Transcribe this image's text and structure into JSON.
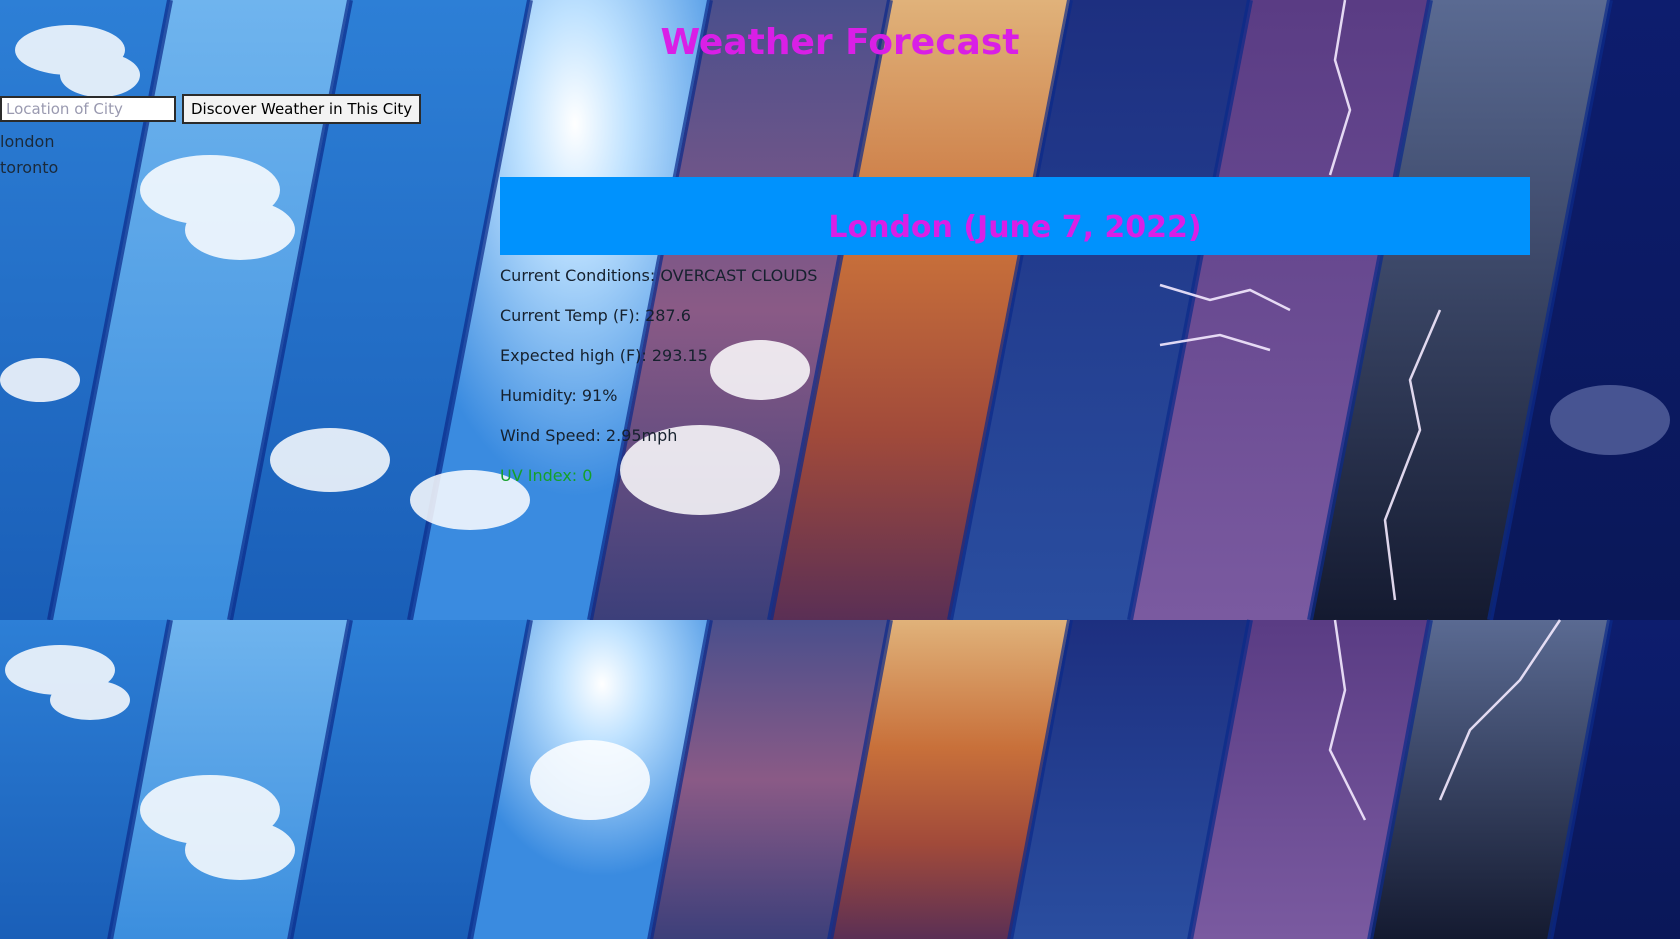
{
  "header": {
    "title": "Weather Forecast"
  },
  "search": {
    "placeholder": "Location of City",
    "value": "",
    "button_label": "Discover Weather in This City"
  },
  "history": {
    "items": [
      "london",
      "toronto"
    ]
  },
  "current": {
    "heading": "London (June 7, 2022)",
    "conditions": "Current Conditions: OVERCAST CLOUDS",
    "temp": "Current Temp (F): 287.6",
    "high": "Expected high (F): 293.15",
    "humidity": "Humidity: 91%",
    "wind": "Wind Speed: 2.95mph",
    "uv": "UV Index: 0"
  },
  "colors": {
    "title": "#d91fe6",
    "header_band": "#0092fd",
    "uv_good": "#14a02a"
  }
}
